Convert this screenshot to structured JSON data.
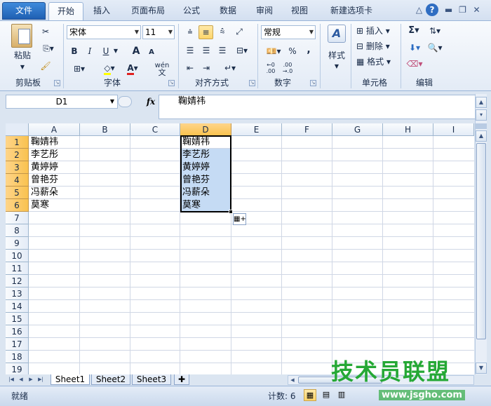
{
  "tabs": {
    "file": "文件",
    "items": [
      "开始",
      "插入",
      "页面布局",
      "公式",
      "数据",
      "审阅",
      "视图",
      "新建选项卡"
    ],
    "active": 0
  },
  "ribbon": {
    "clipboard": {
      "label": "剪贴板",
      "paste": "粘贴"
    },
    "font": {
      "label": "字体",
      "name": "宋体",
      "size": "11",
      "bold": "B",
      "italic": "I",
      "underline": "U",
      "grow": "A",
      "shrink": "A",
      "wen": "wén"
    },
    "align": {
      "label": "对齐方式"
    },
    "number": {
      "label": "数字",
      "format": "常规",
      "percent": "%",
      "comma": ","
    },
    "styles": {
      "label": "样式"
    },
    "cells": {
      "label": "单元格",
      "insert": "插入",
      "delete": "删除",
      "format": "格式"
    },
    "editing": {
      "label": "编辑",
      "sum": "Σ"
    }
  },
  "formula": {
    "namebox": "D1",
    "fx": "fx",
    "value": "鞠婧祎"
  },
  "grid": {
    "columns": [
      "A",
      "B",
      "C",
      "D",
      "E",
      "F",
      "G",
      "H",
      "I"
    ],
    "rows": [
      "1",
      "2",
      "3",
      "4",
      "5",
      "6",
      "7",
      "8",
      "9",
      "10",
      "11",
      "12",
      "13",
      "14",
      "15",
      "16",
      "17",
      "18",
      "19"
    ],
    "colA": [
      "鞠婧祎",
      "李艺彤",
      "黄婷婷",
      "曾艳芬",
      "冯薪朵",
      "莫寒"
    ],
    "colD": [
      "鞠婧祎",
      "李艺彤",
      "黄婷婷",
      "曾艳芬",
      "冯薪朵",
      "莫寒"
    ]
  },
  "sheets": [
    "Sheet1",
    "Sheet2",
    "Sheet3"
  ],
  "status": {
    "ready": "就绪",
    "count": "计数: 6"
  },
  "watermark": {
    "text": "技术员联盟",
    "url": "www.jsgho.com"
  }
}
